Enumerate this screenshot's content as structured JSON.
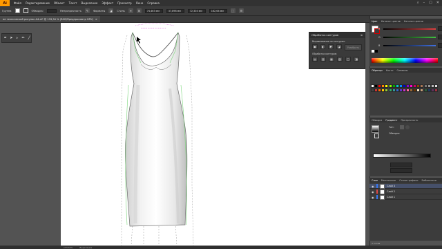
{
  "menubar": {
    "logo": "Ai",
    "items": [
      "Файл",
      "Редактирование",
      "Объект",
      "Текст",
      "Выделение",
      "Эффект",
      "Просмотр",
      "Окно",
      "Справка"
    ],
    "right_icons": [
      "search-icon",
      "minimize-icon",
      "maximize-icon",
      "close-icon"
    ]
  },
  "control": {
    "group_label": "Группа",
    "stroke_label": "Обводка:",
    "stroke_value": "",
    "style_label": "Непрозрачность",
    "format_label": "Форматы",
    "opacity_label": "Стиль",
    "x_value": "74,463 мм",
    "y_value": "37,898 мм",
    "w_value": "72,304 мм",
    "h_value": "162,64 мм"
  },
  "doc_tab": {
    "title": "ее технический рисунок А4.ai* @ 133,34 % (RGB/Предпросмотр GPU)",
    "close": "×"
  },
  "contour_panel": {
    "title": "Обработка контуров",
    "section1": "Выравнивание по контурам:",
    "section2": "Обработка контуров:",
    "expand_label": "Разобрать",
    "row1_icons": [
      "unite-icon",
      "minus-front-icon",
      "intersect-icon",
      "exclude-icon"
    ],
    "row2_icons": [
      "divide-icon",
      "trim-icon",
      "merge-icon",
      "crop-icon",
      "outline-icon",
      "minus-back-icon"
    ]
  },
  "color_panel": {
    "tabs": [
      "Цвет",
      "Каталог цветов",
      "Каталог цветов"
    ],
    "sliders": [
      {
        "label": "R",
        "color": "#e04040"
      },
      {
        "label": "G",
        "color": "#40c040"
      },
      {
        "label": "B",
        "color": "#4070e0"
      }
    ]
  },
  "swatches_panel": {
    "tabs": [
      "Образцы",
      "Кисти",
      "Символы"
    ],
    "colors": [
      "#ffffff",
      "#000000",
      "#ff0000",
      "#ff8800",
      "#ffff00",
      "#88ff00",
      "#00aa00",
      "#00cccc",
      "#0088ff",
      "#0000cc",
      "#8800cc",
      "#ff00cc",
      "#cc0066",
      "#884400",
      "#aa7755",
      "#777777",
      "#999999",
      "#bbbbbb",
      "#dddddd",
      "#444444",
      "#cc3333",
      "#ff6600",
      "#ffcc00",
      "#99cc33",
      "#33aa66",
      "#339999",
      "#3366cc",
      "#6633cc",
      "#cc33cc",
      "#ff6699",
      "#996633",
      "#663300",
      "#f4e1c1",
      "#c8a07a",
      "#2b5e3a",
      "#1f3c66",
      "#603060",
      "#a03040"
    ]
  },
  "gradient_panel": {
    "tabs": [
      "Обводка",
      "Градиент",
      "Прозрачность"
    ],
    "type_label": "Тип:",
    "stroke_label": "Обводка:"
  },
  "layers_panel": {
    "tabs": [
      "Слои",
      "Монтажные",
      "Стили графики",
      "Библиотеки"
    ],
    "rows": [
      {
        "name": "Слой 3",
        "color": "#3a78f0"
      },
      {
        "name": "Слой 2",
        "color": "#e04848"
      },
      {
        "name": "Слой 1",
        "color": "#3a78f0"
      }
    ],
    "footer": "3 Слоев"
  },
  "status": {
    "zoom": "133,34%",
    "tool": "Выделение"
  },
  "colors": {
    "accent": "#FF9A00",
    "guide_green": "#7ad57a",
    "guide_magenta": "#d44ad4"
  }
}
